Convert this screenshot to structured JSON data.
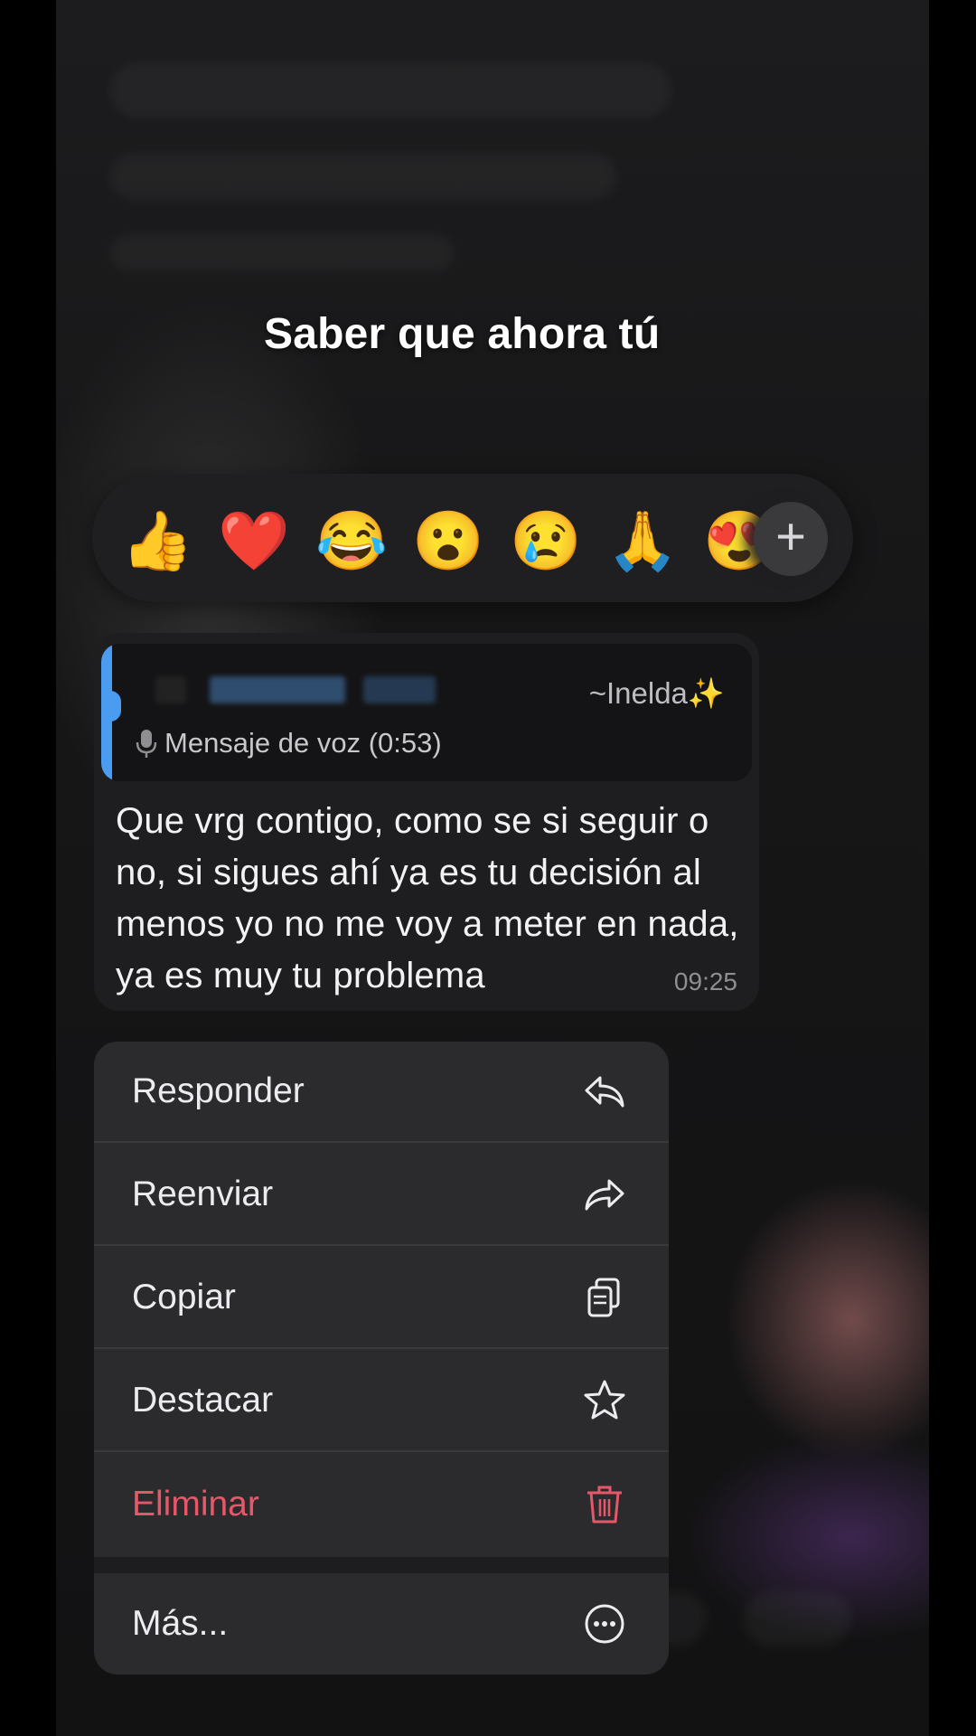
{
  "overlay_caption": "Saber que ahora tú",
  "reactions": [
    {
      "emoji": "👍",
      "name": "thumbs-up"
    },
    {
      "emoji": "❤️",
      "name": "red-heart"
    },
    {
      "emoji": "😂",
      "name": "tears-of-joy"
    },
    {
      "emoji": "😮",
      "name": "surprised-face"
    },
    {
      "emoji": "😢",
      "name": "crying-face"
    },
    {
      "emoji": "🙏",
      "name": "folded-hands"
    },
    {
      "emoji": "😍",
      "name": "heart-eyes"
    }
  ],
  "more_reactions_icon": "plus-icon",
  "message": {
    "quote_author": "~Inelda✨",
    "quote_preview": "Mensaje de voz (0:53)",
    "quote_icon": "microphone-icon",
    "text": "Que vrg contigo, como se si seguir o no, si sigues ahí ya es tu decisión al menos yo no me voy a meter en nada, ya es muy tu problema",
    "time": "09:25"
  },
  "menu": {
    "items": [
      {
        "label": "Responder",
        "icon": "reply-icon"
      },
      {
        "label": "Reenviar",
        "icon": "forward-icon"
      },
      {
        "label": "Copiar",
        "icon": "copy-icon"
      },
      {
        "label": "Destacar",
        "icon": "star-icon"
      },
      {
        "label": "Eliminar",
        "icon": "trash-icon",
        "color": "#e7576a"
      },
      {
        "label": "Más...",
        "icon": "more-icon"
      }
    ]
  },
  "colors": {
    "accent_quote_bar": "#4a9cf0",
    "danger": "#e7576a"
  }
}
